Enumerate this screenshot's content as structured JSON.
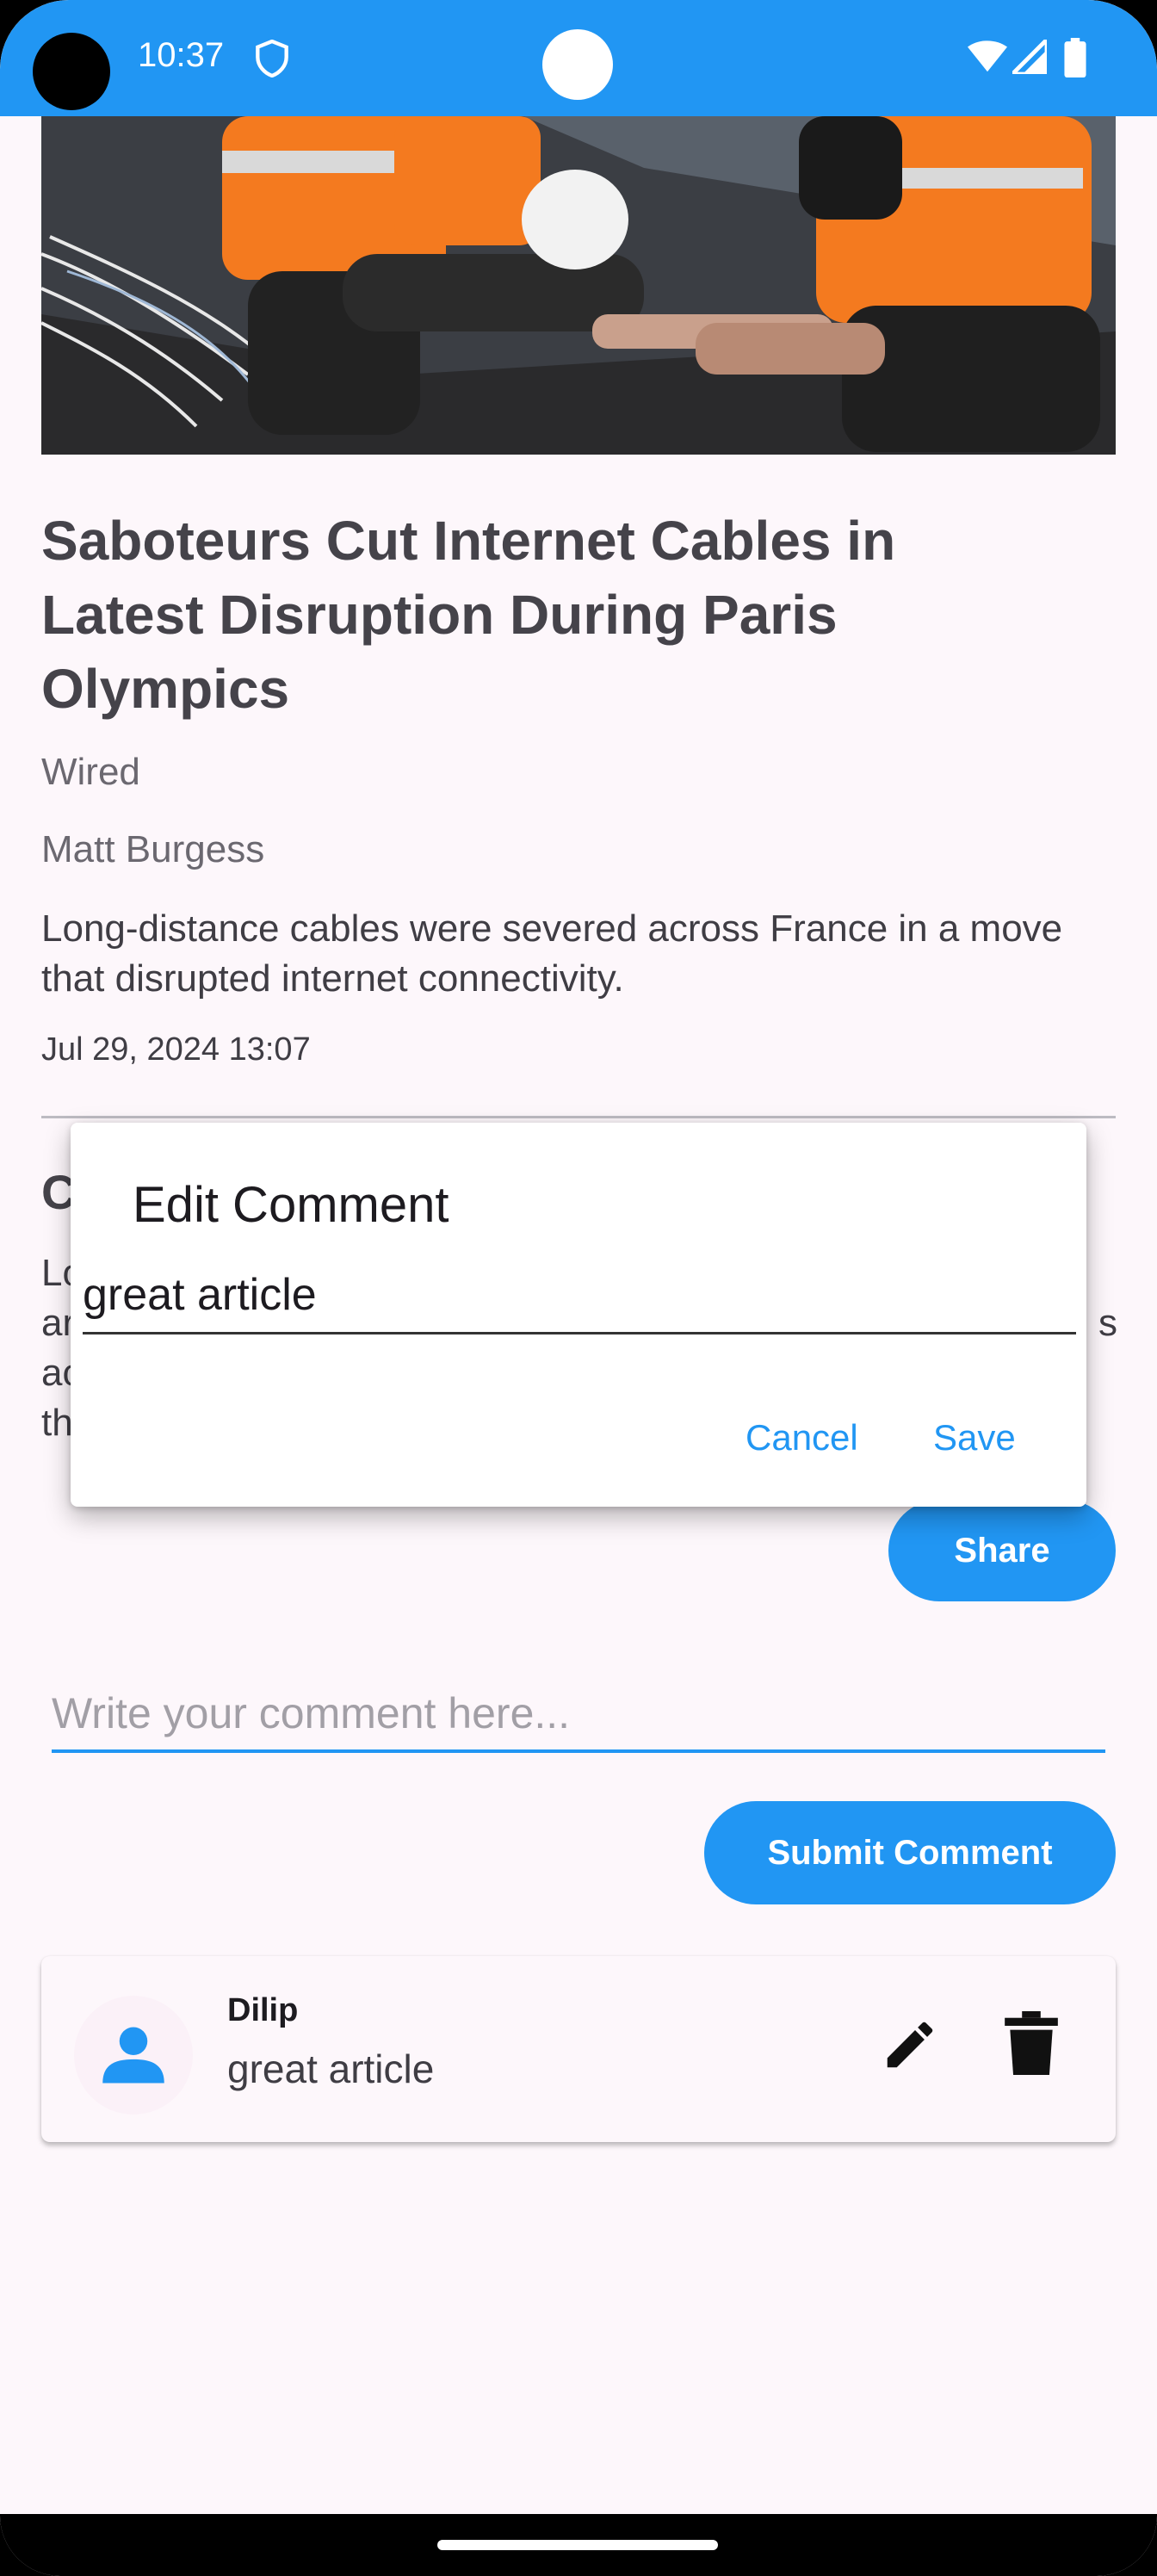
{
  "status_bar": {
    "time": "10:37",
    "icons": [
      "shield-icon",
      "wifi-icon",
      "signal-icon",
      "battery-icon"
    ]
  },
  "article": {
    "image": "construction-workers-photo",
    "headline": "Saboteurs Cut Internet Cables in Latest Disruption During Paris Olympics",
    "source": "Wired",
    "author": "Matt Burgess",
    "summary": "Long-distance cables were severed across France in a move that disrupted internet connectivity.",
    "date": "Jul 29, 2024 13:07",
    "content_heading_visible": "C",
    "content_lines_visible": [
      "Lo",
      "ar",
      "ac",
      "th"
    ],
    "content_line2_tail": "s"
  },
  "actions": {
    "share_label": "Share",
    "comment_placeholder": "Write your comment here...",
    "submit_label": "Submit Comment"
  },
  "comments": [
    {
      "user": "Dilip",
      "text": "great article",
      "avatar_icon": "person-icon"
    }
  ],
  "dialog": {
    "title": "Edit Comment",
    "value": "great article",
    "cancel_label": "Cancel",
    "save_label": "Save"
  },
  "colors": {
    "accent": "#2196f3",
    "background": "#fdf7fb",
    "text": "#45434a"
  }
}
